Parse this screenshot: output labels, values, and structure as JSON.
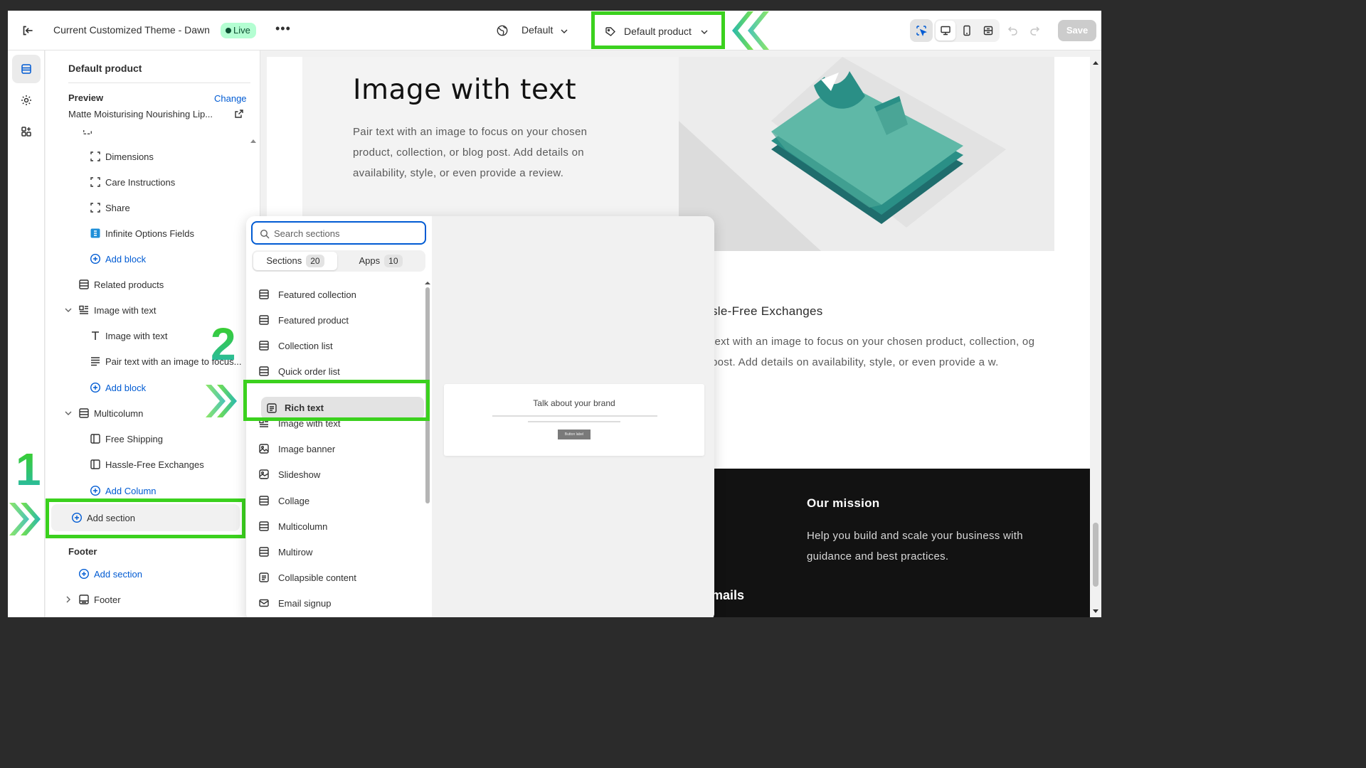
{
  "topbar": {
    "theme_title": "Current Customized Theme - Dawn",
    "live_badge": "Live",
    "more": "•••",
    "language_select": "Default",
    "template_select": "Default product",
    "save_label": "Save"
  },
  "sidebar": {
    "header": "Default product",
    "preview_label": "Preview",
    "change_link": "Change",
    "preview_product": "Matte Moisturising Nourishing Lip...",
    "items": [
      {
        "label": "Dimensions",
        "icon": "block-icon"
      },
      {
        "label": "Care Instructions",
        "icon": "block-icon"
      },
      {
        "label": "Share",
        "icon": "block-icon"
      },
      {
        "label": "Infinite Options Fields",
        "icon": "app-block-icon"
      },
      {
        "label": "Add block",
        "icon": "plus-circle-icon"
      },
      {
        "label": "Related products",
        "icon": "section-icon"
      },
      {
        "label": "Image with text",
        "icon": "image-text-section-icon"
      },
      {
        "label": "Image with text",
        "icon": "text-icon"
      },
      {
        "label": "Pair text with an image to focus...",
        "icon": "paragraph-icon"
      },
      {
        "label": "Add block",
        "icon": "plus-circle-icon"
      },
      {
        "label": "Multicolumn",
        "icon": "section-icon"
      },
      {
        "label": "Free Shipping",
        "icon": "column-icon"
      },
      {
        "label": "Hassle-Free Exchanges",
        "icon": "column-icon"
      },
      {
        "label": "Add Column",
        "icon": "plus-circle-icon"
      },
      {
        "label": "Add section",
        "icon": "plus-circle-icon"
      }
    ],
    "footer_group_label": "Footer",
    "footer_add_section": "Add section",
    "footer_item": "Footer"
  },
  "steps": {
    "one": "1",
    "two": "2"
  },
  "popover": {
    "search_placeholder": "Search sections",
    "tabs": [
      {
        "label": "Sections",
        "count": "20"
      },
      {
        "label": "Apps",
        "count": "10"
      }
    ],
    "items": [
      "Featured collection",
      "Featured product",
      "Collection list",
      "Quick order list",
      "Rich text",
      "Image with text",
      "Image banner",
      "Slideshow",
      "Collage",
      "Multicolumn",
      "Multirow",
      "Collapsible content",
      "Email signup"
    ],
    "preview_title": "Talk about your brand",
    "preview_button": "Button label"
  },
  "canvas": {
    "iwt_title": "Image with text",
    "iwt_body": "Pair text with an image to focus on your chosen product, collection, or blog post. Add details on availability, style, or even provide a review.",
    "multicolumn_title": "sle-Free Exchanges",
    "multicolumn_body": "text with an image to focus on your chosen product, collection, og post. Add details on availability, style, or even provide a w.",
    "mission_title": "Our mission",
    "mission_body": "Help you build and scale your business with guidance and best practices.",
    "emails_fragment": "mails"
  },
  "colors": {
    "highlight": "#3bd11e",
    "link": "#005bd3",
    "live_bg": "#b4fed2",
    "tshirt": "#5fb8a7"
  }
}
